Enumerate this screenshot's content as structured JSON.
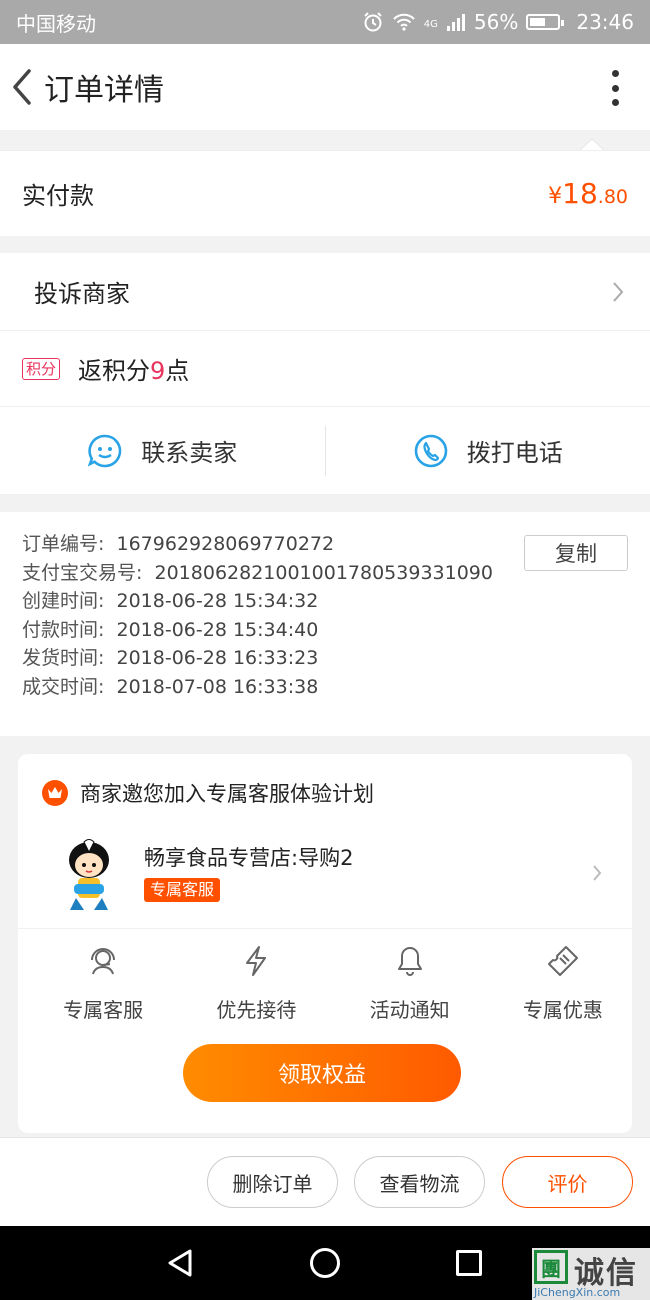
{
  "status_bar": {
    "carrier": "中国移动",
    "network": "4G",
    "battery": "56%",
    "time": "23:46"
  },
  "header": {
    "title": "订单详情"
  },
  "payment": {
    "label": "实付款",
    "currency": "¥",
    "amount_int": "18",
    "amount_dec": ".80"
  },
  "actions": {
    "complain": "投诉商家",
    "points_badge": "积分",
    "points_prefix": "返积分",
    "points_value": "9",
    "points_suffix": "点",
    "contact_seller": "联系卖家",
    "call_phone": "拨打电话"
  },
  "order_info": {
    "copy_label": "复制",
    "rows": [
      {
        "key": "订单编号:",
        "value": "167962928069770272"
      },
      {
        "key": "支付宝交易号:",
        "value": "2018062821001001780539331090"
      },
      {
        "key": "创建时间:",
        "value": "2018-06-28 15:34:32"
      },
      {
        "key": "付款时间:",
        "value": "2018-06-28 15:34:40"
      },
      {
        "key": "发货时间:",
        "value": "2018-06-28 16:33:23"
      },
      {
        "key": "成交时间:",
        "value": "2018-07-08 16:33:38"
      }
    ]
  },
  "service_plan": {
    "title": "商家邀您加入专属客服体验计划",
    "shop_name": "畅享食品专营店:导购2",
    "shop_tag": "专属客服",
    "benefits": [
      {
        "label": "专属客服",
        "icon": "headset-icon"
      },
      {
        "label": "优先接待",
        "icon": "lightning-icon"
      },
      {
        "label": "活动通知",
        "icon": "bell-icon"
      },
      {
        "label": "专属优惠",
        "icon": "coupon-icon"
      }
    ],
    "claim_button": "领取权益"
  },
  "bottom_bar": {
    "delete_order": "删除订单",
    "view_logistics": "查看物流",
    "review": "评价"
  },
  "watermark": {
    "box": "團",
    "text": "诚信",
    "sub": "JiChengXin.com"
  },
  "colors": {
    "accent": "#ff5000",
    "points": "#e8335c",
    "chat_blue": "#2aa3e6"
  }
}
